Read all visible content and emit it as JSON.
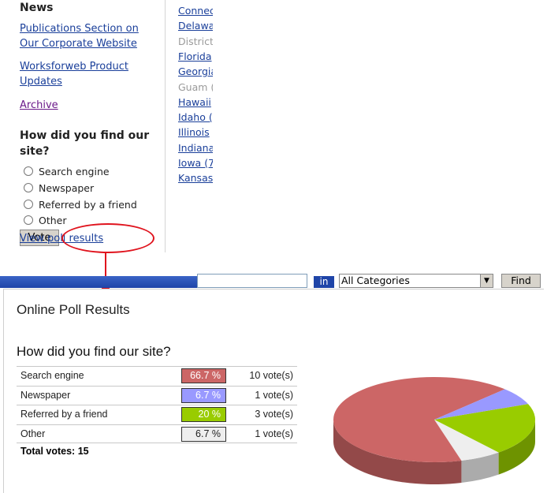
{
  "sidebar": {
    "news_title": "News",
    "links": [
      "Publications Section on Our Corporate Website",
      "Worksforweb Product Updates",
      "Archive"
    ],
    "poll": {
      "question": "How did you find our site?",
      "options": [
        "Search engine",
        "Newspaper",
        "Referred by a friend",
        "Other"
      ],
      "vote_label": "Vote",
      "results_link": "View poll results"
    }
  },
  "states": [
    {
      "label": "Connec",
      "state": "link"
    },
    {
      "label": "Delawa",
      "state": "link"
    },
    {
      "label": "District",
      "state": "dim"
    },
    {
      "label": "Florida",
      "state": "link"
    },
    {
      "label": "Georgia",
      "state": "link"
    },
    {
      "label": "Guam (",
      "state": "dim"
    },
    {
      "label": "Hawaii",
      "state": "link"
    },
    {
      "label": "Idaho (",
      "state": "link"
    },
    {
      "label": "Illinois",
      "state": "link"
    },
    {
      "label": "Indiana",
      "state": "link"
    },
    {
      "label": "Iowa (7",
      "state": "link"
    },
    {
      "label": "Kansas",
      "state": "link"
    }
  ],
  "search": {
    "in_label": "in",
    "category": "All Categories",
    "find_label": "Find"
  },
  "results": {
    "title": "Online Poll Results",
    "question": "How did you find our site?",
    "rows": [
      {
        "label": "Search engine",
        "percent": "66.7 %",
        "votes": "10 vote(s)"
      },
      {
        "label": "Newspaper",
        "percent": "6.7 %",
        "votes": "1 vote(s)"
      },
      {
        "label": "Referred by a friend",
        "percent": "20 %",
        "votes": "3 vote(s)"
      },
      {
        "label": "Other",
        "percent": "6.7 %",
        "votes": "1 vote(s)"
      }
    ],
    "total": "Total votes: 15"
  },
  "colors": {
    "search_engine": "#cc6666",
    "newspaper": "#9999ff",
    "friend": "#99cc00",
    "other": "#eeeeee",
    "link": "#1a3f9a",
    "visited": "#6b1a8a",
    "annotation": "#e0141e"
  },
  "chart_data": {
    "type": "pie",
    "categories": [
      "Search engine",
      "Newspaper",
      "Referred by a friend",
      "Other"
    ],
    "values": [
      10,
      1,
      3,
      1
    ],
    "colors": [
      "#cc6666",
      "#9999ff",
      "#99cc00",
      "#eeeeee"
    ]
  }
}
